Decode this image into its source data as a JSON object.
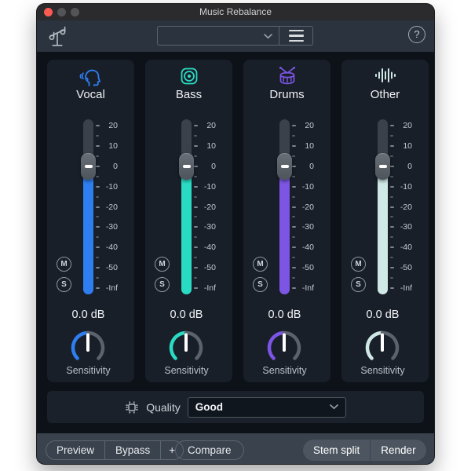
{
  "window": {
    "title": "Music Rebalance"
  },
  "toolbar": {
    "preset_value": "",
    "help_glyph": "?"
  },
  "channels": [
    {
      "id": "vocal",
      "label": "Vocal",
      "icon": "vocal-icon",
      "accent": "#2e7ef2",
      "value_db": "0.0 dB"
    },
    {
      "id": "bass",
      "label": "Bass",
      "icon": "bass-speaker-icon",
      "accent": "#2adbc3",
      "value_db": "0.0 dB"
    },
    {
      "id": "drums",
      "label": "Drums",
      "icon": "drums-icon",
      "accent": "#7c55e4",
      "value_db": "0.0 dB"
    },
    {
      "id": "other",
      "label": "Other",
      "icon": "waveform-icon",
      "accent": "#cfe9e6",
      "value_db": "0.0 dB"
    }
  ],
  "fader": {
    "scale_labels": [
      "20",
      "10",
      "0",
      "-10",
      "-20",
      "-30",
      "-40",
      "-50",
      "-Inf"
    ],
    "mute_label": "M",
    "solo_label": "S",
    "sensitivity_label": "Sensitivity"
  },
  "quality": {
    "label": "Quality",
    "value": "Good"
  },
  "footer": {
    "left_buttons": [
      "Preview",
      "Bypass",
      "+"
    ],
    "compare_label": "Compare",
    "right_buttons": [
      "Stem split",
      "Render"
    ]
  }
}
